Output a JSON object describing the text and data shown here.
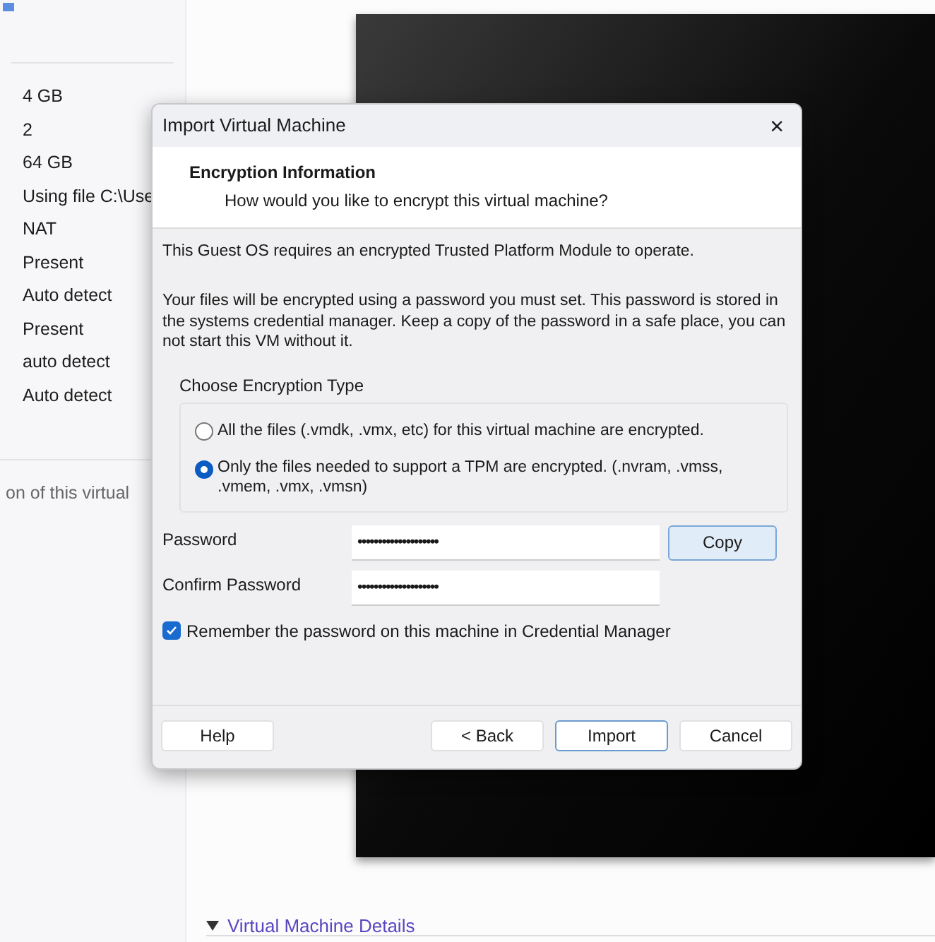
{
  "background": {
    "details_values": [
      "4 GB",
      "2",
      "64 GB",
      "Using file C:\\Use",
      "NAT",
      "Present",
      "Auto detect",
      "Present",
      "auto detect",
      "Auto detect"
    ],
    "description": "on of this virtual",
    "section_header": "Virtual Machine Details"
  },
  "dialog": {
    "title": "Import Virtual Machine",
    "close": "×",
    "header": {
      "title": "Encryption Information",
      "subtitle": "How would you like to encrypt this virtual machine?"
    },
    "notice": "This Guest OS requires an encrypted Trusted Platform Module to operate.",
    "explanation": "Your files will be encrypted using a password you must set. This password is stored in the systems credential manager. Keep a copy of the password in a safe place, you can not start this VM without it.",
    "encryption_group": {
      "label": "Choose Encryption Type",
      "options": [
        {
          "label": "All the files (.vmdk, .vmx, etc) for this virtual machine are encrypted.",
          "selected": false
        },
        {
          "label": "Only the files needed to support a TPM are encrypted. (.nvram, .vmss, .vmem, .vmx, .vmsn)",
          "selected": true
        }
      ]
    },
    "password": {
      "label": "Password",
      "value": "••••••••••••••••••••",
      "copy_button": "Copy"
    },
    "confirm_password": {
      "label": "Confirm Password",
      "value": "••••••••••••••••••••"
    },
    "remember": {
      "label": "Remember the password on this machine in Credential Manager",
      "checked": true
    },
    "buttons": [
      {
        "label": "Help",
        "default": false
      },
      {
        "label": "< Back",
        "default": false
      },
      {
        "label": "Import",
        "default": true
      },
      {
        "label": "Cancel",
        "default": false
      }
    ]
  }
}
